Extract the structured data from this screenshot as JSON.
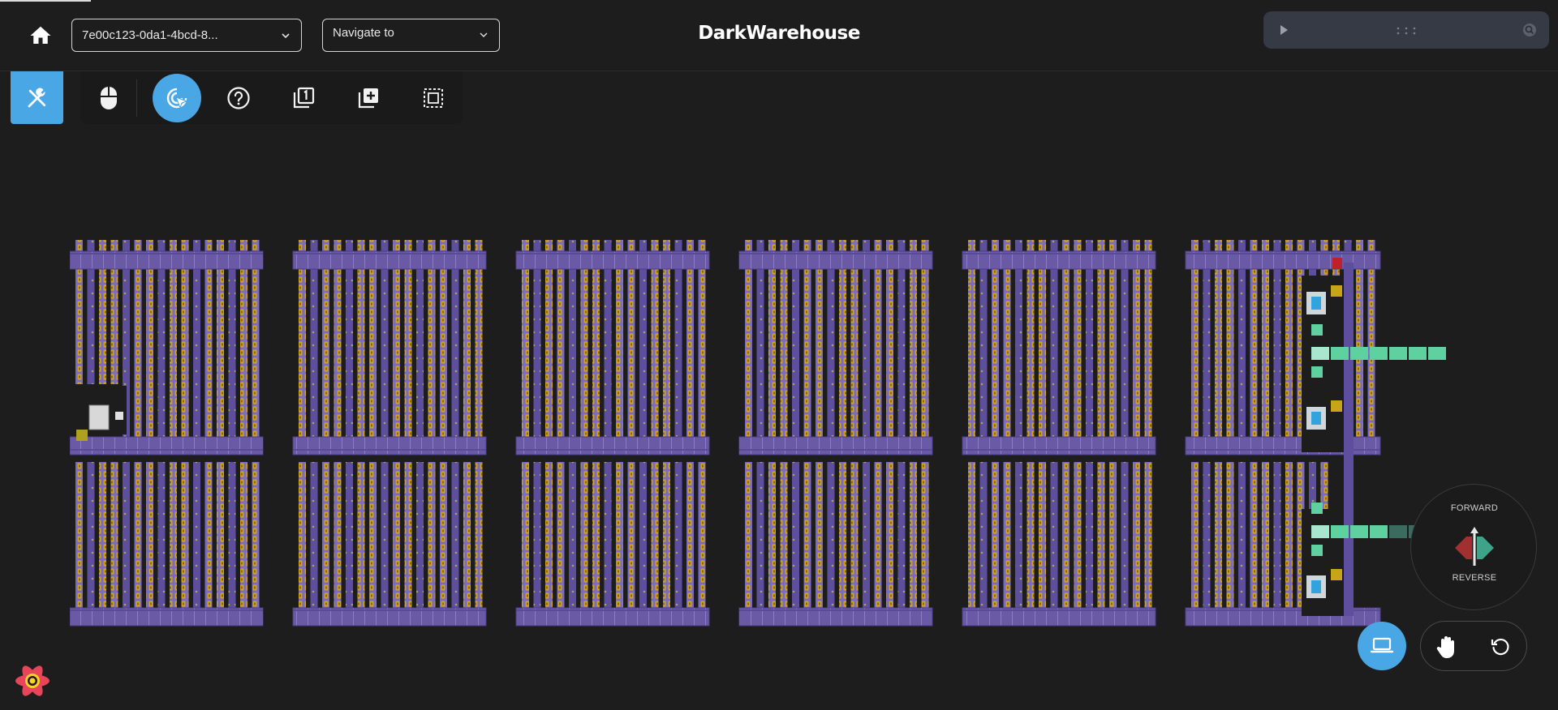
{
  "app": {
    "title": "DarkWarehouse"
  },
  "header": {
    "project_select": {
      "value": "7e00c123-0da1-4bcd-8..."
    },
    "navigate_select": {
      "value": "Navigate to"
    }
  },
  "toolbar": {
    "tools": [
      {
        "name": "mouse-tool",
        "icon": "mouse-icon",
        "active": false
      },
      {
        "name": "select-tool",
        "icon": "cursor-click-icon",
        "active": true
      },
      {
        "name": "help-tool",
        "icon": "question-icon",
        "active": false
      },
      {
        "name": "single-layer-tool",
        "icon": "layer-one-icon",
        "active": false
      },
      {
        "name": "add-layer-tool",
        "icon": "add-layer-icon",
        "active": false
      },
      {
        "name": "region-select-tool",
        "icon": "dashed-select-icon",
        "active": false
      }
    ]
  },
  "direction_control": {
    "forward_label": "FORWARD",
    "reverse_label": "REVERSE"
  },
  "colors": {
    "accent": "#4aa7e6",
    "conveyor": "#6a5aa6",
    "rack_slot": "#d4a418",
    "robot": "#31a4de",
    "station": "#5fd1a0",
    "background": "#1d1d1d"
  }
}
